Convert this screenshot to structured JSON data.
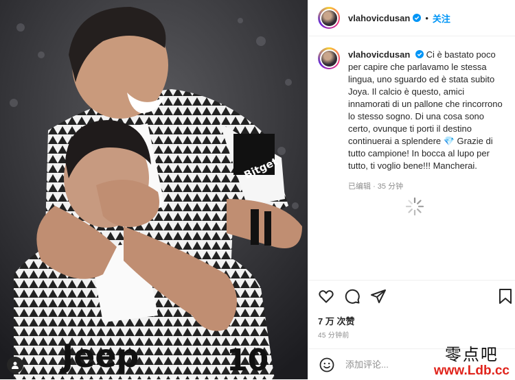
{
  "post": {
    "username": "vlahovicdusan",
    "follow_label": "关注",
    "separator": "•",
    "caption": "Ci è bastato poco per capire che parlavamo le stessa lingua, uno sguardo ed è stata subito Joya. Il calcio è questo, amici innamorati di un pallone che rincorrono lo stesso sogno. Di una cosa sono certo, ovunque ti porti il destino continuerai a splendere 💎 Grazie di tutto campione! In bocca al lupo per tutto, ti voglio bene!!! Mancherai.",
    "edited_label": "已编辑",
    "edited_sep": "·",
    "edited_time": "35 分钟",
    "likes": "7 万 次赞",
    "posted_ago": "45 分钟前",
    "comment_placeholder": "添加评论..."
  },
  "photo": {
    "jersey_sponsor": "Jeep",
    "jersey_number": "10",
    "bitget_label": "Bitget"
  },
  "watermark": {
    "line1": "零点吧",
    "line2": "www.Ldb.cc"
  },
  "icons": [
    "heart-icon",
    "comment-icon",
    "share-icon",
    "bookmark-icon",
    "emoji-icon",
    "verified-icon",
    "loading-spinner-icon",
    "tag-user-icon"
  ],
  "colors": {
    "accent": "#0095f6",
    "text": "#262626",
    "muted": "#8e8e8e",
    "watermark_red": "#e0241c"
  }
}
